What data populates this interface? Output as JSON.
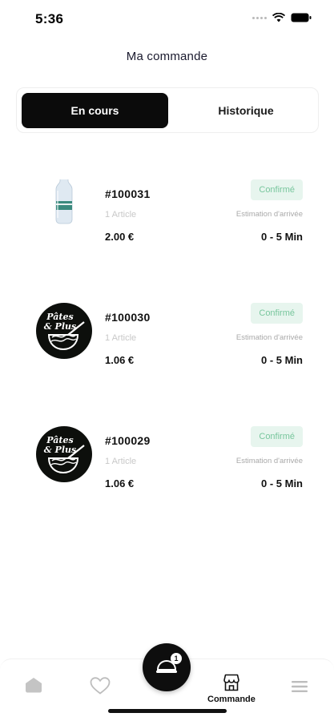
{
  "status_bar": {
    "time": "5:36"
  },
  "header": {
    "title": "Ma commande"
  },
  "segments": {
    "active": "En cours",
    "inactive": "Historique"
  },
  "orders": [
    {
      "id": "#100031",
      "count": "1 Article",
      "price": "2.00 €",
      "status": "Confirmé",
      "eta_label": "Estimation d'arrivée",
      "eta": "0 - 5 Min",
      "thumb": "water-bottle-icon"
    },
    {
      "id": "#100030",
      "count": "1 Article",
      "price": "1.06 €",
      "status": "Confirmé",
      "eta_label": "Estimation d'arrivée",
      "eta": "0 - 5 Min",
      "thumb": "pates-plus-logo"
    },
    {
      "id": "#100029",
      "count": "1 Article",
      "price": "1.06 €",
      "status": "Confirmé",
      "eta_label": "Estimation d'arrivée",
      "eta": "0 - 5 Min",
      "thumb": "pates-plus-logo"
    }
  ],
  "logo": {
    "line1": "Pâtes",
    "line2": "& Plus"
  },
  "tabbar": {
    "commande_label": "Commande",
    "cart_badge": "1",
    "icons": [
      "home-icon",
      "heart-icon",
      "cart-icon",
      "store-icon",
      "menu-icon"
    ]
  },
  "colors": {
    "accent": "#0b0b0b",
    "status_bg": "#e7f5ee",
    "status_text": "#78c69d"
  }
}
